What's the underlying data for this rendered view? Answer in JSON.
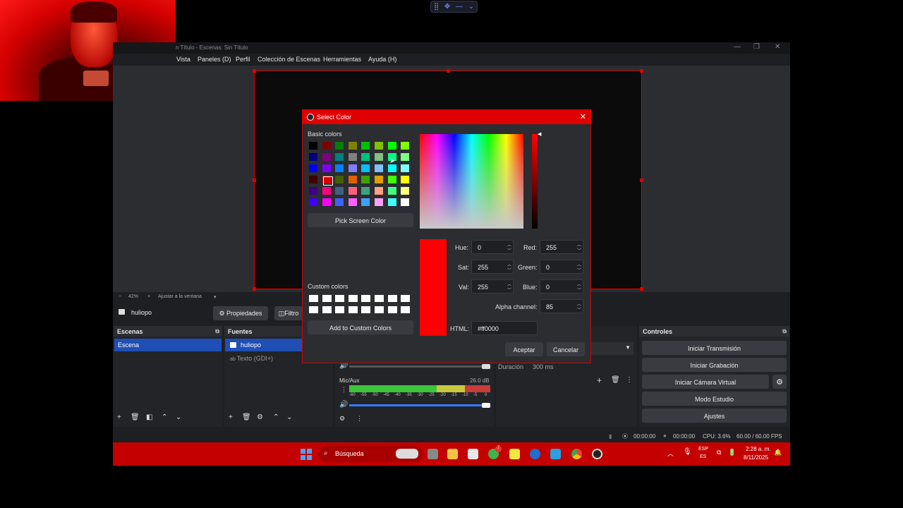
{
  "topbar": {
    "icons": [
      "grid-icon",
      "move-icon",
      "minimize-icon",
      "chevron-down-icon"
    ],
    "glyphs": [
      "⣿",
      "✥",
      "—",
      "⌄"
    ]
  },
  "obs": {
    "title": "n Título - Escenas: Sin Título",
    "window_controls": [
      "—",
      "❐",
      "✕"
    ],
    "menu": [
      "Vista",
      "Paneles (D)",
      "Perfil",
      "Colección de Escenas",
      "Herramientas",
      "Ayuda (H)"
    ],
    "zoom": {
      "minus": "−",
      "value": "42%",
      "plus": "+",
      "fit": "Ajustar a la ventana",
      "dropdown": "▾"
    },
    "source_bar": {
      "source_name": "huliopo",
      "properties": "Propiedades",
      "filters": "Filtro"
    },
    "scenes": {
      "title": "Escenas",
      "items": [
        "Escena"
      ]
    },
    "sources": {
      "title": "Fuentes",
      "items": [
        {
          "name": "huliopo",
          "icon": "camera-icon"
        },
        {
          "name": "Texto (GDI+)",
          "icon": "text-icon"
        }
      ]
    },
    "mixer": {
      "channel": "Mic/Aux",
      "level": "26.0 dB",
      "ticks": [
        "-60",
        "-55",
        "-50",
        "-45",
        "-40",
        "-35",
        "-30",
        "-25",
        "-20",
        "-15",
        "-10",
        "-5",
        "0"
      ]
    },
    "transitions": {
      "duration_label": "Duración",
      "duration_value": "300 ms"
    },
    "controls": {
      "title": "Controles",
      "buttons": [
        "Iniciar Transmisión",
        "Iniciar Grabación",
        "Iniciar Cámara Virtual",
        "Modo Estudio",
        "Ajustes"
      ]
    },
    "status": {
      "stream_time": "00:00:00",
      "rec_time": "00:00:00",
      "cpu": "CPU: 3.6%",
      "fps": "60.00 / 60.00 FPS"
    }
  },
  "dialog": {
    "title": "Select Color",
    "close": "✕",
    "basic_label": "Basic colors",
    "basic_colors": [
      "#000000",
      "#800000",
      "#008000",
      "#808000",
      "#00c000",
      "#80c000",
      "#00ff00",
      "#80ff00",
      "#000080",
      "#800080",
      "#008080",
      "#808080",
      "#00c080",
      "#80c080",
      "#00ff80",
      "#80ff80",
      "#0000ff",
      "#8000ff",
      "#0080ff",
      "#8080ff",
      "#00c0ff",
      "#80c0ff",
      "#00ffff",
      "#80ffff",
      "#400000",
      "#e00000",
      "#406000",
      "#e06000",
      "#40a000",
      "#e0a000",
      "#40ff00",
      "#ffff00",
      "#400080",
      "#ff0080",
      "#406080",
      "#ff6080",
      "#40a080",
      "#ffa080",
      "#40ff80",
      "#ffff80",
      "#4000ff",
      "#ff00ff",
      "#4060ff",
      "#ff60ff",
      "#40a0ff",
      "#ffa0ff",
      "#40ffff",
      "#ffffff"
    ],
    "pick_screen": "Pick Screen Color",
    "custom_label": "Custom colors",
    "add_custom": "Add to Custom Colors",
    "current_color": "#ff0000",
    "fields": {
      "hue_label": "Hue:",
      "hue": "0",
      "sat_label": "Sat:",
      "sat": "255",
      "val_label": "Val:",
      "val": "255",
      "red_label": "Red:",
      "red": "255",
      "green_label": "Green:",
      "green": "0",
      "blue_label": "Blue:",
      "blue": "0",
      "alpha_label": "Alpha channel:",
      "alpha": "85",
      "html_label": "HTML:",
      "html": "#ff0000"
    },
    "ok": "Aceptar",
    "cancel": "Cancelar"
  },
  "taskbar": {
    "search": "Búsqueda",
    "lang_top": "ESP",
    "lang_bottom": "ES",
    "time": "2:28 a. m.",
    "date": "8/11/2025",
    "badge": "7"
  }
}
